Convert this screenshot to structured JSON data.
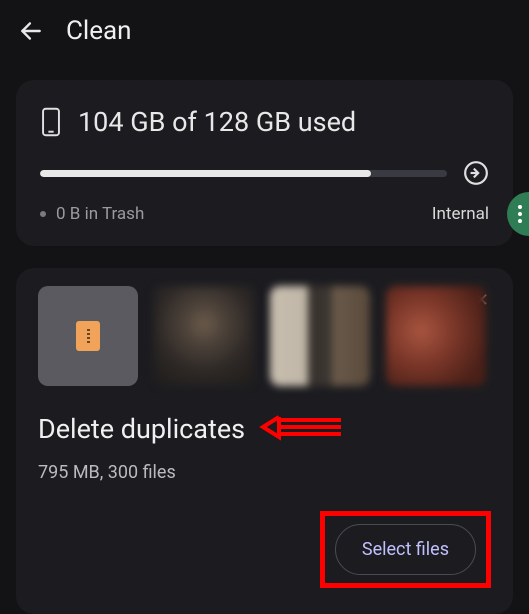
{
  "header": {
    "title": "Clean"
  },
  "storage": {
    "usage_text": "104 GB of 128 GB used",
    "progress_percent": 81.25,
    "trash_text": "0 B in Trash",
    "type_text": "Internal"
  },
  "duplicates": {
    "title": "Delete duplicates",
    "subtitle": "795 MB, 300 files",
    "action_label": "Select files"
  },
  "icons": {
    "back": "back-arrow",
    "phone": "phone-icon",
    "arrow_circle": "arrow-right-circle-icon",
    "close": "✕"
  }
}
